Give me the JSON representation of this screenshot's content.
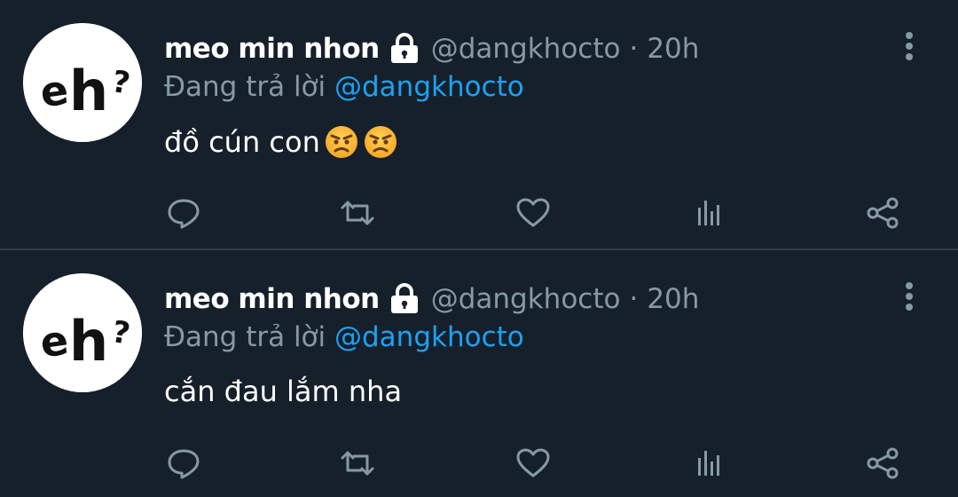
{
  "tweets": [
    {
      "name": "meo min nhon",
      "handle": "@dangkhocto",
      "separator": "·",
      "time": "20h",
      "reply_prefix": "Đang trả lời",
      "reply_to": "@dangkhocto",
      "text": "đồ cún con",
      "emojis": [
        "angry-face",
        "angry-face"
      ],
      "avatar_text": "eh?"
    },
    {
      "name": "meo min nhon",
      "handle": "@dangkhocto",
      "separator": "·",
      "time": "20h",
      "reply_prefix": "Đang trả lời",
      "reply_to": "@dangkhocto",
      "text": "cắn đau lắm nha",
      "emojis": [],
      "avatar_text": "eh?"
    }
  ],
  "icons": {
    "lock": "lock-icon",
    "more": "more-vertical-icon",
    "reply": "reply-icon",
    "retweet": "retweet-icon",
    "like": "heart-icon",
    "analytics": "analytics-icon",
    "share": "share-icon"
  },
  "colors": {
    "background": "#15202b",
    "secondary_text": "#8899a6",
    "link": "#1da1f2",
    "divider": "#2f3b47"
  }
}
